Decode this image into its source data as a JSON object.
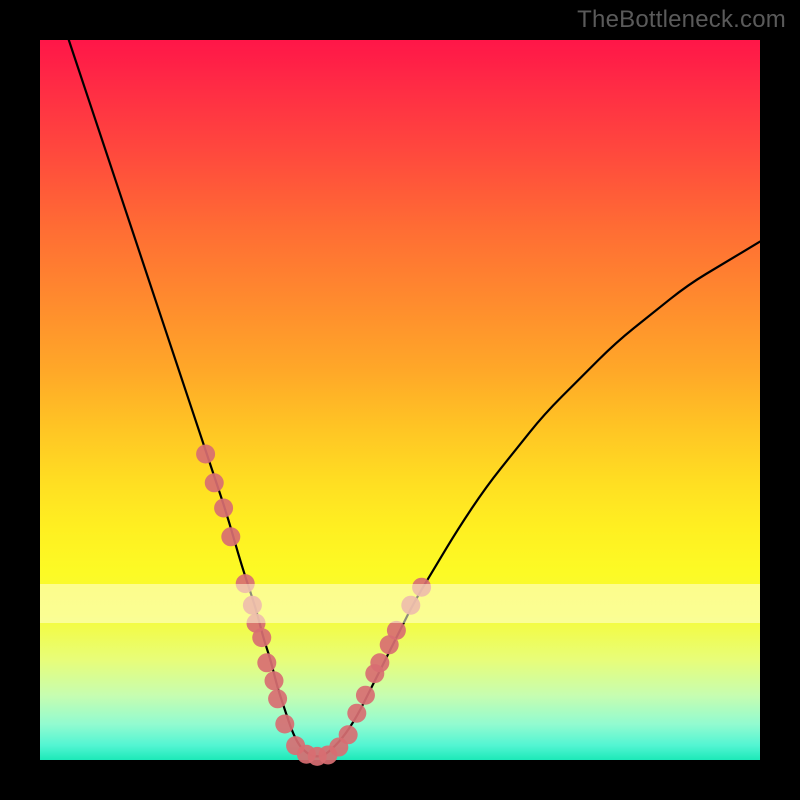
{
  "watermark": "TheBottleneck.com",
  "colors": {
    "curve": "#000000",
    "marker_fill": "#d86e72",
    "marker_stroke": "#d86e72",
    "frame": "#000000"
  },
  "chart_data": {
    "type": "line",
    "title": "",
    "xlabel": "",
    "ylabel": "",
    "xlim": [
      0,
      100
    ],
    "ylim": [
      0,
      100
    ],
    "series": [
      {
        "name": "bottleneck-curve",
        "x": [
          4,
          6,
          8,
          10,
          12,
          14,
          16,
          18,
          20,
          22,
          24,
          26,
          28,
          30,
          31,
          32,
          33,
          34,
          35,
          36,
          37,
          38,
          39,
          40,
          42,
          44,
          46,
          48,
          50,
          52,
          55,
          58,
          62,
          66,
          70,
          75,
          80,
          85,
          90,
          95,
          100
        ],
        "y": [
          100,
          94,
          88,
          82,
          76,
          70,
          64,
          58,
          52,
          46,
          40,
          34,
          27,
          21,
          17,
          14,
          10,
          7,
          4,
          2,
          1,
          0.5,
          0.5,
          1,
          3,
          6,
          10,
          14,
          18,
          22,
          27,
          32,
          38,
          43,
          48,
          53,
          58,
          62,
          66,
          69,
          72
        ]
      }
    ],
    "markers": [
      {
        "x": 23.0,
        "y": 42.5
      },
      {
        "x": 24.2,
        "y": 38.5
      },
      {
        "x": 25.5,
        "y": 35.0
      },
      {
        "x": 26.5,
        "y": 31.0
      },
      {
        "x": 28.5,
        "y": 24.5
      },
      {
        "x": 29.5,
        "y": 21.5
      },
      {
        "x": 30.0,
        "y": 19.0
      },
      {
        "x": 30.8,
        "y": 17.0
      },
      {
        "x": 31.5,
        "y": 13.5
      },
      {
        "x": 32.5,
        "y": 11.0
      },
      {
        "x": 33.0,
        "y": 8.5
      },
      {
        "x": 34.0,
        "y": 5.0
      },
      {
        "x": 35.5,
        "y": 2.0
      },
      {
        "x": 37.0,
        "y": 0.8
      },
      {
        "x": 38.5,
        "y": 0.5
      },
      {
        "x": 40.0,
        "y": 0.7
      },
      {
        "x": 41.5,
        "y": 1.8
      },
      {
        "x": 42.8,
        "y": 3.5
      },
      {
        "x": 44.0,
        "y": 6.5
      },
      {
        "x": 45.2,
        "y": 9.0
      },
      {
        "x": 46.5,
        "y": 12.0
      },
      {
        "x": 47.2,
        "y": 13.5
      },
      {
        "x": 48.5,
        "y": 16.0
      },
      {
        "x": 49.5,
        "y": 18.0
      },
      {
        "x": 51.5,
        "y": 21.5
      },
      {
        "x": 53.0,
        "y": 24.0
      }
    ]
  }
}
